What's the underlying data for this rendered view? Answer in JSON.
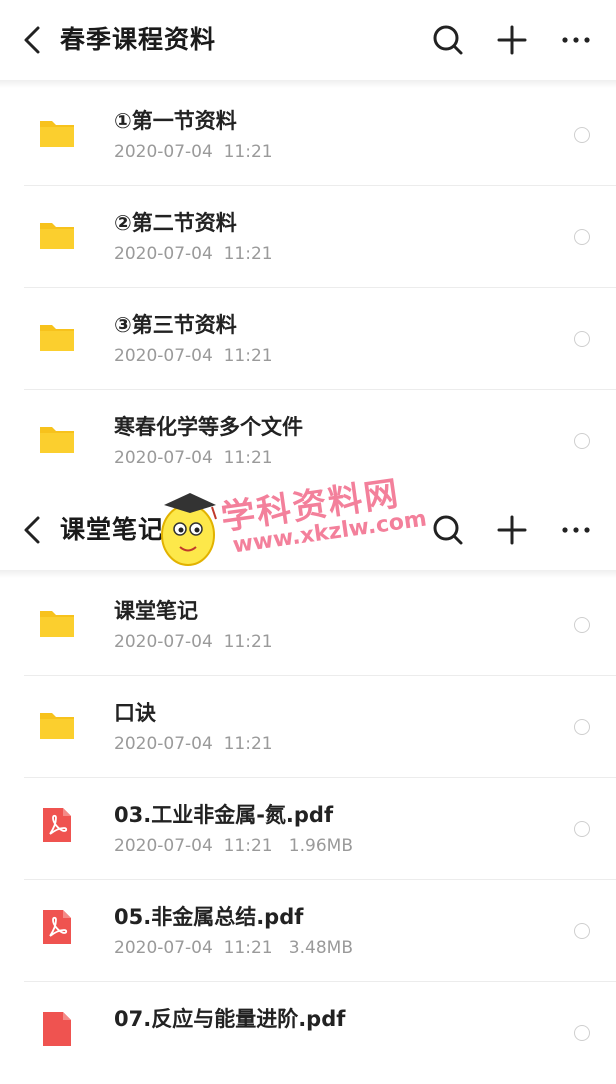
{
  "top_panel": {
    "title": "春季课程资料",
    "items": [
      {
        "name": "①第一节资料",
        "meta": "2020-07-04  11:21",
        "type": "folder"
      },
      {
        "name": "②第二节资料",
        "meta": "2020-07-04  11:21",
        "type": "folder"
      },
      {
        "name": "③第三节资料",
        "meta": "2020-07-04  11:21",
        "type": "folder"
      },
      {
        "name": "寒春化学等多个文件",
        "meta": "2020-07-04  11:21",
        "type": "folder"
      }
    ]
  },
  "bottom_panel": {
    "title": "课堂笔记",
    "items": [
      {
        "name": "课堂笔记",
        "meta": "2020-07-04  11:21",
        "type": "folder"
      },
      {
        "name": "口诀",
        "meta": "2020-07-04  11:21",
        "type": "folder"
      },
      {
        "name": "03.工业非金属-氮.pdf",
        "meta": "2020-07-04  11:21   1.96MB",
        "type": "pdf"
      },
      {
        "name": "05.非金属总结.pdf",
        "meta": "2020-07-04  11:21   3.48MB",
        "type": "pdf"
      },
      {
        "name": "07.反应与能量进阶.pdf",
        "meta": "",
        "type": "pdf"
      }
    ]
  },
  "watermark": {
    "title": "学科资料网",
    "url": "www.xkzlw.com"
  },
  "colors": {
    "folder": "#f7c21c",
    "pdf": "#ef5350",
    "watermark": "#f26a8a"
  },
  "icons": {
    "back": "chevron-left-icon",
    "search": "search-icon",
    "add": "plus-icon",
    "more": "more-horizontal-icon",
    "folder": "folder-icon",
    "pdf": "pdf-file-icon"
  }
}
